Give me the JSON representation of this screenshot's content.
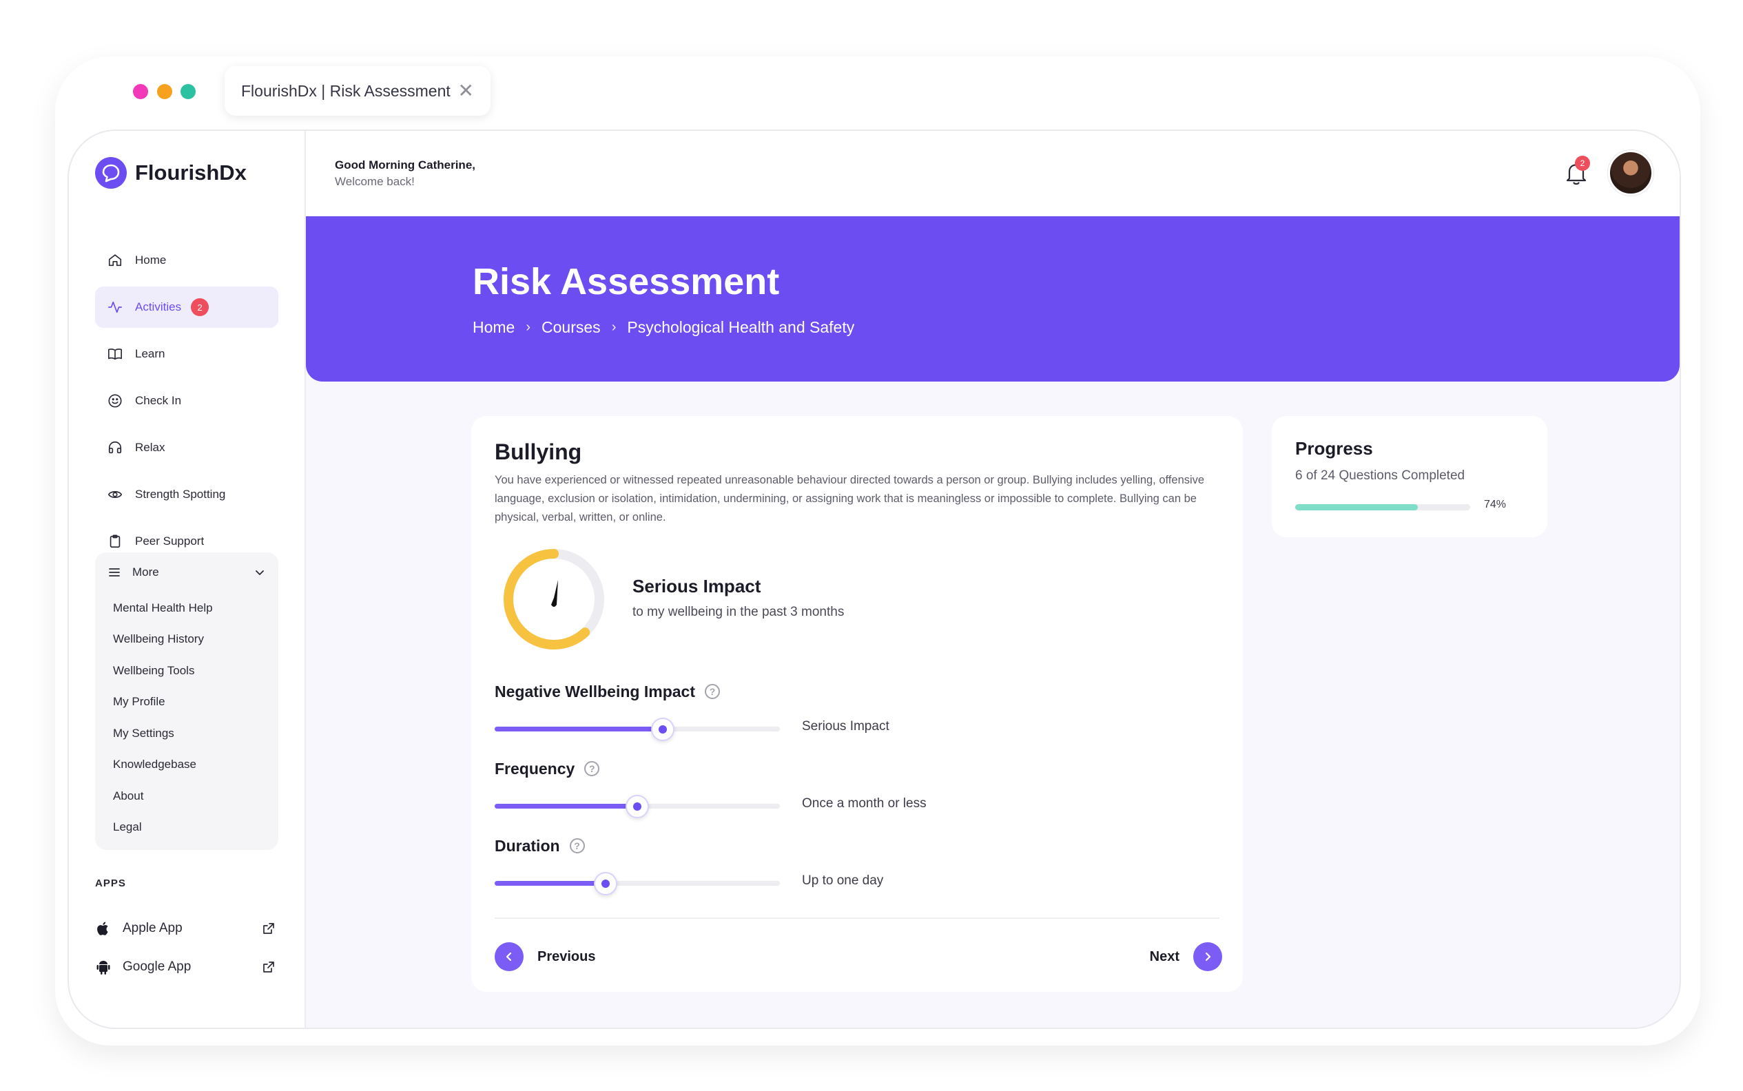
{
  "browser": {
    "tab_title": "FlourishDx | Risk Assessment"
  },
  "app": {
    "logo_text": "FlourishDx",
    "accent": "#6c4df2"
  },
  "sidebar": {
    "items": [
      {
        "label": "Home",
        "icon": "home-icon"
      },
      {
        "label": "Activities",
        "icon": "activity-icon",
        "badge": "2",
        "active": true
      },
      {
        "label": "Learn",
        "icon": "book-icon"
      },
      {
        "label": "Check In",
        "icon": "smile-icon"
      },
      {
        "label": "Relax",
        "icon": "headphones-icon"
      },
      {
        "label": "Strength Spotting",
        "icon": "eye-icon"
      },
      {
        "label": "Peer Support",
        "icon": "clipboard-icon"
      }
    ],
    "more": {
      "label": "More",
      "items": [
        "Mental Health Help",
        "Wellbeing History",
        "Wellbeing Tools",
        "My Profile",
        "My Settings",
        "Knowledgebase",
        "About",
        "Legal"
      ]
    },
    "apps_label": "APPS",
    "apps": [
      {
        "label": "Apple App",
        "icon": "apple-icon"
      },
      {
        "label": "Google App",
        "icon": "android-icon"
      }
    ]
  },
  "header": {
    "greeting": "Good Morning Catherine,",
    "welcome": "Welcome back!",
    "notification_count": "2"
  },
  "hero": {
    "title": "Risk Assessment",
    "breadcrumb": [
      "Home",
      "Courses",
      "Psychological Health and Safety"
    ]
  },
  "question": {
    "title": "Bullying",
    "description": "You have experienced or witnessed repeated unreasonable behaviour directed towards a person or group. Bullying includes yelling, offensive language, exclusion or isolation, intimidation, undermining, or assigning work that is meaningless or impossible to complete. Bullying can be physical, verbal, written, or online.",
    "impact_title": "Serious Impact",
    "impact_subtitle": "to my wellbeing in the past 3 months",
    "gauge_fraction": 0.62,
    "gauge_color": "#f7c23f",
    "sliders": [
      {
        "label": "Negative Wellbeing Impact",
        "value_text": "Serious Impact",
        "fraction": 0.59
      },
      {
        "label": "Frequency",
        "value_text": "Once a month or less",
        "fraction": 0.5
      },
      {
        "label": "Duration",
        "value_text": "Up to one day",
        "fraction": 0.39
      }
    ],
    "previous_label": "Previous",
    "next_label": "Next"
  },
  "progress": {
    "title": "Progress",
    "subtitle": "6 of 24 Questions Completed",
    "percent_text": "74%",
    "fraction": 0.7,
    "bar_color": "#7fdec8"
  }
}
